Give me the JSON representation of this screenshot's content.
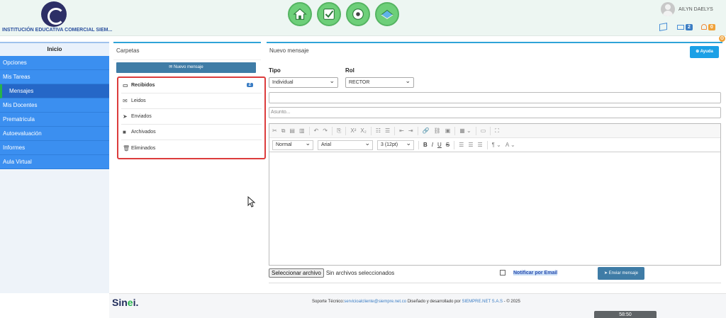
{
  "header": {
    "school_name": "INSTITUCIÓN EDUCATIVA COMERCIAL SIEM...",
    "user_name": "AILYN DAELYS",
    "mail_count": "2",
    "alert_count": "0",
    "nav_icons": [
      "home-icon",
      "checklist-icon",
      "soccer-ball-icon",
      "book-icon"
    ]
  },
  "sidebar": {
    "title": "Inicio",
    "items": [
      {
        "label": "Opciones"
      },
      {
        "label": "Mis Tareas"
      },
      {
        "label": "Mensajes",
        "active": true
      },
      {
        "label": "Mis Docentes"
      },
      {
        "label": "Prematricula"
      },
      {
        "label": "Autoevaluación"
      },
      {
        "label": "Informes"
      },
      {
        "label": "Aula Virtual"
      }
    ]
  },
  "folders": {
    "title": "Carpetas",
    "new_message_label": "Nuevo mensaje",
    "items": [
      {
        "label": "Recibidos",
        "icon": "inbox-icon",
        "badge": "2"
      },
      {
        "label": "Leidos",
        "icon": "envelope-icon"
      },
      {
        "label": "Enviados",
        "icon": "paper-plane-icon"
      },
      {
        "label": "Archivados",
        "icon": "archive-icon"
      },
      {
        "label": "Eliminados",
        "icon": "trash-icon"
      }
    ]
  },
  "compose": {
    "title": "Nuevo mensaje",
    "help_label": "Ayuda",
    "tipo_label": "Tipo",
    "tipo_value": "Individual",
    "rol_label": "Rol",
    "rol_value": "RECTOR",
    "recipient_value": "",
    "subject_placeholder": "Asunto...",
    "format_value": "Normal",
    "font_value": "Arial",
    "size_value": "3 (12pt)",
    "file_button_label": "Seleccionar archivo",
    "file_status": "Sin archivos seleccionados",
    "notify_label": "Notificar por Email",
    "send_label": "Enviar mensaje"
  },
  "footer": {
    "logo_prefix": "Sin",
    "logo_dot": "e",
    "logo_suffix": "i.",
    "support_label": "Soporte Técnico:",
    "support_email": "servicioalcliente@siempre.net.co",
    "designed_by": " Diseñado y desarrollado por ",
    "company": "SIEMPRE.NET S.A.S",
    "copyright": " -  © 2025",
    "timer": "58:50"
  },
  "colors": {
    "sidebar_blue": "#3b8ff0",
    "accent_teal": "#2fa3d8",
    "nav_green": "#6dcf79",
    "highlight_red": "#dc3c3c"
  }
}
